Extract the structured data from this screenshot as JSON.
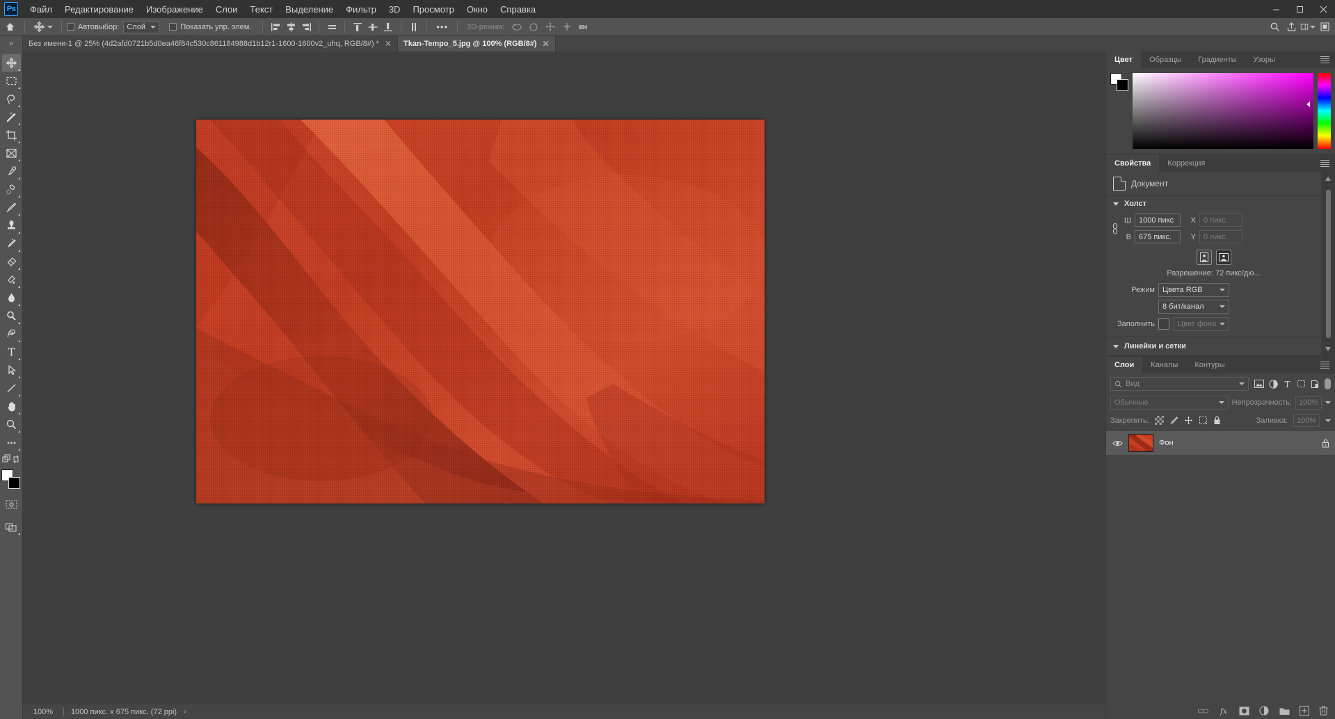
{
  "app": {
    "name": "Ps",
    "logo_color": "#31a8ff"
  },
  "window_controls": {
    "minimize": "—",
    "maximize": "❐",
    "close": "✕"
  },
  "menu": {
    "items": [
      {
        "label": "Файл"
      },
      {
        "label": "Редактирование"
      },
      {
        "label": "Изображение"
      },
      {
        "label": "Слои"
      },
      {
        "label": "Текст"
      },
      {
        "label": "Выделение"
      },
      {
        "label": "Фильтр"
      },
      {
        "label": "3D"
      },
      {
        "label": "Просмотр"
      },
      {
        "label": "Окно"
      },
      {
        "label": "Справка"
      }
    ]
  },
  "options_bar": {
    "autoselect_label": "Автовыбор:",
    "autoselect_checked": false,
    "autoselect_scope": "Слой",
    "show_controls_label": "Показать упр. элем.",
    "show_controls_checked": false,
    "more_label": "•••",
    "mode3d_label": "3D-режим:"
  },
  "tabs": [
    {
      "title": "Без имени-1 @ 25% (4d2afd0721b5d0ea46f84c530c861184988d1b12r1-1600-1600v2_uhq, RGB/8#) *",
      "active": false,
      "close": "✕"
    },
    {
      "title": "Tkan-Tempo_5.jpg @ 100% (RGB/8#)",
      "active": true,
      "close": "✕"
    }
  ],
  "toolbar": {
    "tools": [
      {
        "name": "move-tool",
        "active": true
      },
      {
        "name": "rectangular-marquee-tool",
        "active": false
      },
      {
        "name": "lasso-tool",
        "active": false
      },
      {
        "name": "magic-wand-tool",
        "active": false
      },
      {
        "name": "crop-tool",
        "active": false
      },
      {
        "name": "frame-tool",
        "active": false
      },
      {
        "name": "eyedropper-tool",
        "active": false
      },
      {
        "name": "healing-brush-tool",
        "active": false
      },
      {
        "name": "brush-tool",
        "active": false
      },
      {
        "name": "clone-stamp-tool",
        "active": false
      },
      {
        "name": "history-brush-tool",
        "active": false
      },
      {
        "name": "eraser-tool",
        "active": false
      },
      {
        "name": "gradient-tool",
        "active": false
      },
      {
        "name": "blur-tool",
        "active": false
      },
      {
        "name": "dodge-tool",
        "active": false
      },
      {
        "name": "pen-tool",
        "active": false
      },
      {
        "name": "type-tool",
        "active": false
      },
      {
        "name": "path-selection-tool",
        "active": false
      },
      {
        "name": "line-tool",
        "active": false
      },
      {
        "name": "hand-tool",
        "active": false
      },
      {
        "name": "zoom-tool",
        "active": false
      },
      {
        "name": "more-tools",
        "active": false
      }
    ],
    "foreground_color": "#ffffff",
    "background_color": "#000000"
  },
  "canvas": {
    "image_name": "Tkan-Tempo_5.jpg",
    "base_color": "#c63d20",
    "shadow_color": "#8e2815",
    "highlight_color": "#e05a34"
  },
  "status_bar": {
    "zoom": "100%",
    "doc_info": "1000 пикс. x 675 пикс. (72 ppi)",
    "arrow": "›"
  },
  "color_panel": {
    "tabs": [
      {
        "label": "Цвет",
        "active": true
      },
      {
        "label": "Образцы",
        "active": false
      },
      {
        "label": "Градиенты",
        "active": false
      },
      {
        "label": "Узоры",
        "active": false
      }
    ],
    "foreground_color": "#ffffff",
    "background_color": "#000000"
  },
  "properties_panel": {
    "tabs": [
      {
        "label": "Свойства",
        "active": true
      },
      {
        "label": "Коррекция",
        "active": false
      }
    ],
    "document_label": "Документ",
    "canvas_section": {
      "title": "Холст",
      "width_label": "Ш",
      "width_value": "1000 пикс",
      "height_label": "В",
      "height_value": "675 пикс.",
      "x_label": "X",
      "x_placeholder": "0 пикс.",
      "y_label": "Y",
      "y_placeholder": "0 пикс.",
      "resolution": "Разрешение: 72 пикс/дю...",
      "mode_label": "Режим",
      "mode_value": "Цвета RGB",
      "depth_value": "8 бит/канал",
      "fill_label": "Заполнить",
      "fill_value": "Цвет фона"
    },
    "rulers_section": {
      "title": "Линейки и сетки"
    }
  },
  "layers_panel": {
    "tabs": [
      {
        "label": "Слои",
        "active": true
      },
      {
        "label": "Каналы",
        "active": false
      },
      {
        "label": "Контуры",
        "active": false
      }
    ],
    "filter_placeholder": "Вид",
    "blend_mode": "Обычные",
    "opacity_label": "Непрозрачность:",
    "opacity_value": "100%",
    "lock_label": "Закрепить:",
    "fill_label": "Заливка:",
    "fill_value": "100%",
    "layers": [
      {
        "name": "Фон",
        "visible": true,
        "locked": true
      }
    ],
    "footer_icons": [
      "link-layers-icon",
      "fx-icon",
      "layer-mask-icon",
      "adjustment-layer-icon",
      "new-group-icon",
      "new-layer-icon",
      "delete-layer-icon"
    ]
  }
}
